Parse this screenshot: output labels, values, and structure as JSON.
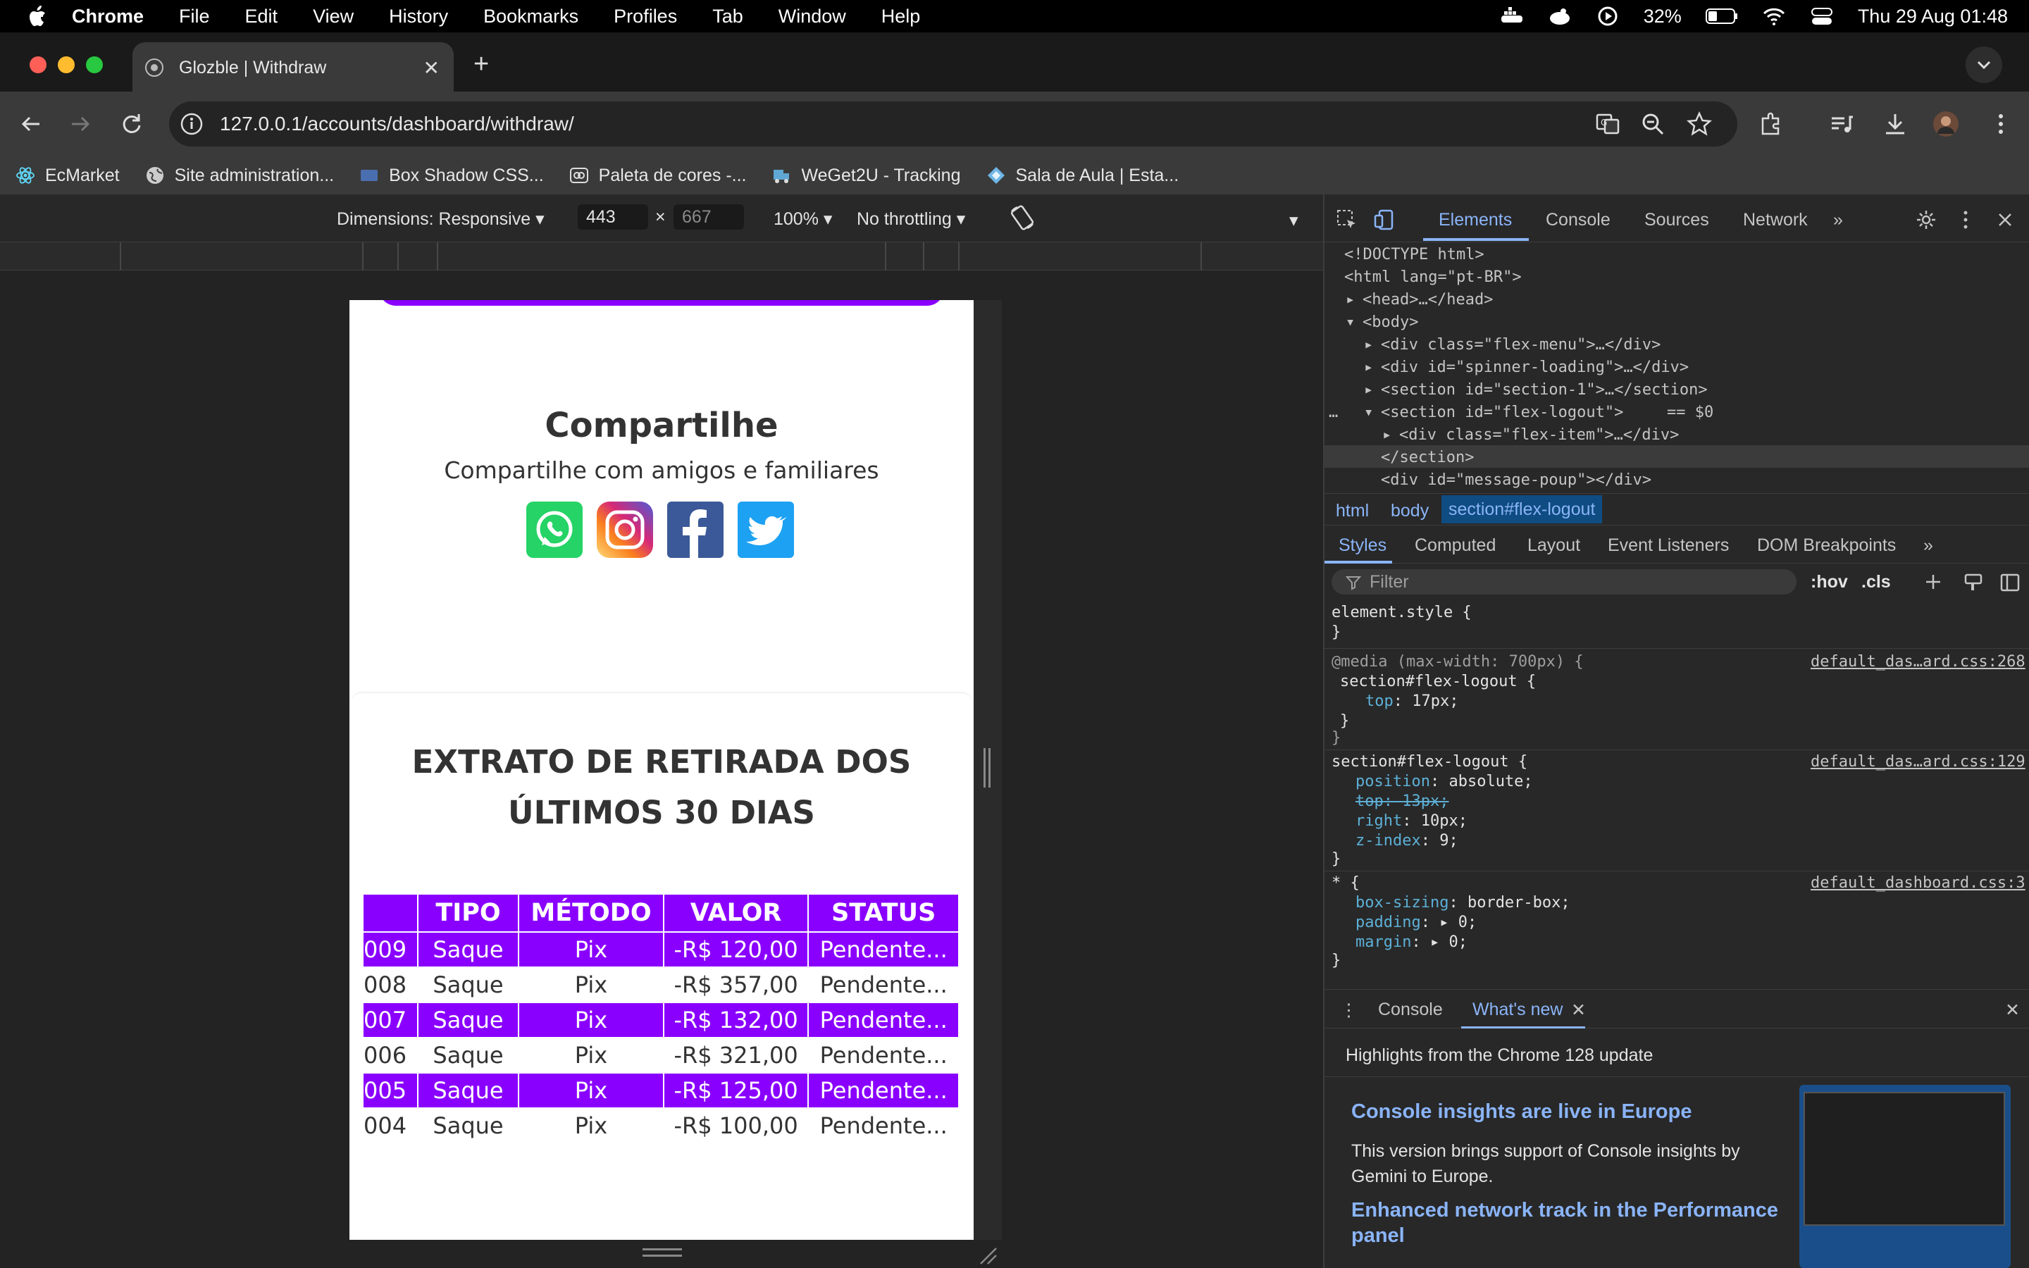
{
  "menubar": {
    "app": "Chrome",
    "items": [
      "File",
      "Edit",
      "View",
      "History",
      "Bookmarks",
      "Profiles",
      "Tab",
      "Window",
      "Help"
    ],
    "battery": "32%",
    "datetime": "Thu 29 Aug  01:48"
  },
  "browser": {
    "tab_title": "Glozble | Withdraw",
    "url": "127.0.0.1/accounts/dashboard/withdraw/",
    "bookmarks": [
      "EcMarket",
      "Site administration...",
      "Box Shadow CSS...",
      "Paleta de cores -...",
      "WeGet2U - Tracking",
      "Sala de Aula | Esta..."
    ]
  },
  "device_toolbar": {
    "dimensions": "Dimensions: Responsive",
    "width": "443",
    "times": "×",
    "height": "667",
    "zoom": "100%",
    "throttling": "No throttling"
  },
  "page": {
    "share_title": "Compartilhe",
    "share_subtitle": "Compartilhe com amigos e familiares",
    "extrato_title_line1": "EXTRATO DE RETIRADA DOS",
    "extrato_title_line2": "ÚLTIMOS 30 DIAS",
    "table": {
      "headers": [
        "",
        "TIPO",
        "MÉTODO",
        "VALOR",
        "STATUS"
      ],
      "rows": [
        [
          "009",
          "Saque",
          "Pix",
          "-R$ 120,00",
          "Pendente..."
        ],
        [
          "008",
          "Saque",
          "Pix",
          "-R$ 357,00",
          "Pendente..."
        ],
        [
          "007",
          "Saque",
          "Pix",
          "-R$ 132,00",
          "Pendente..."
        ],
        [
          "006",
          "Saque",
          "Pix",
          "-R$ 321,00",
          "Pendente..."
        ],
        [
          "005",
          "Saque",
          "Pix",
          "-R$ 125,00",
          "Pendente..."
        ],
        [
          "004",
          "Saque",
          "Pix",
          "-R$ 100,00",
          "Pendente..."
        ]
      ]
    }
  },
  "devtools": {
    "tabs": [
      "Elements",
      "Console",
      "Sources",
      "Network"
    ],
    "dom": {
      "doctype": "<!DOCTYPE html>",
      "html_open": "<html lang=\"pt-BR\">",
      "head": "<head>…</head>",
      "body_open": "<body>",
      "div_menu": "<div class=\"flex-menu\">…</div>",
      "div_spinner": "<div id=\"spinner-loading\">…</div>",
      "section1": "<section id=\"section-1\">…</section>",
      "section_logout": "<section id=\"flex-logout\">",
      "selected_marker": "== $0",
      "div_flex_item": "<div class=\"flex-item\">…</div>",
      "section_close": "</section>",
      "div_message": "<div id=\"message-poup\"></div>"
    },
    "breadcrumbs": [
      "html",
      "body",
      "section#flex-logout"
    ],
    "subtabs": [
      "Styles",
      "Computed",
      "Layout",
      "Event Listeners",
      "DOM Breakpoints"
    ],
    "filter_placeholder": "Filter",
    "hov": ":hov",
    "cls": ".cls",
    "styles": {
      "element_style": "element.style {",
      "close": "}",
      "media": "@media (max-width: 700px) {",
      "media_selector": "section#flex-logout {",
      "media_prop": "top",
      "media_val": "17px;",
      "media_src": "default_das…ard.css:268",
      "rule_selector": "section#flex-logout {",
      "rule_src": "default_das…ard.css:129",
      "props": [
        {
          "name": "position",
          "value": "absolute;"
        },
        {
          "name": "top",
          "value": "13px;"
        },
        {
          "name": "right",
          "value": "10px;"
        },
        {
          "name": "z-index",
          "value": "9;"
        }
      ],
      "universal_selector": "* {",
      "universal_src": "default_dashboard.css:3",
      "uprops": [
        {
          "name": "box-sizing",
          "value": "border-box;"
        },
        {
          "name": "padding",
          "value": "0;"
        },
        {
          "name": "margin",
          "value": "0;"
        }
      ]
    },
    "drawer_tabs": [
      "Console",
      "What's new"
    ],
    "whats_new": {
      "heading": "Highlights from the Chrome 128 update",
      "title1": "Console insights are live in Europe",
      "para1": "This version brings support of Console insights by Gemini to Europe.",
      "title2": "Enhanced network track in the Performance panel"
    }
  },
  "colors": {
    "accent_purple": "#8a00ff",
    "devtools_blue": "#8ab4f8"
  }
}
